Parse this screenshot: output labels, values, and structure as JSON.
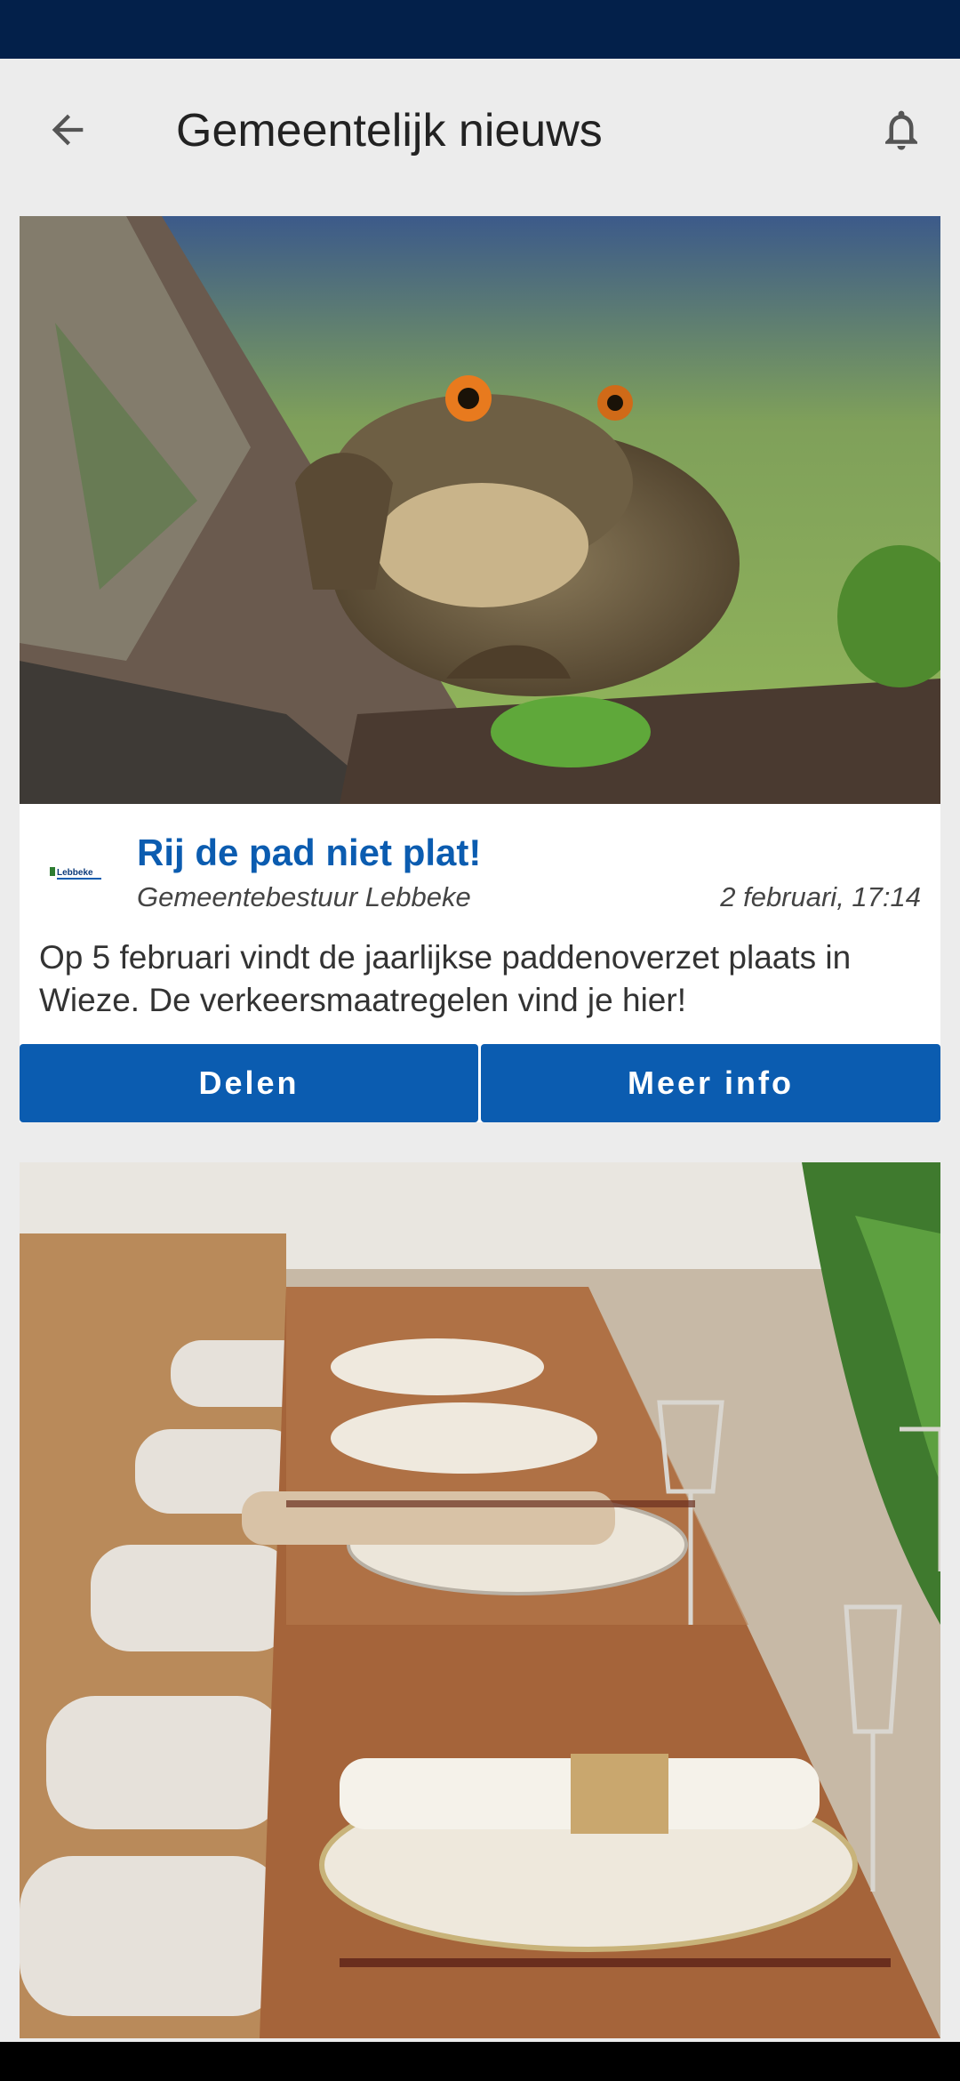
{
  "app_bar": {
    "title": "Gemeentelijk nieuws",
    "back_icon": "arrow-left-icon",
    "notification_icon": "bell-icon"
  },
  "feed": [
    {
      "image_subject": "toad on mossy tree bark",
      "source_logo_text": "Lebbeke",
      "title": "Rij de pad niet plat!",
      "source": "Gemeentebestuur Lebbeke",
      "date": "2 februari, 17:14",
      "body": "Op 5 februari vindt de jaarlijkse paddenoverzet plaats in Wieze. De verkeersmaatregelen vind je hier!",
      "share_label": "Delen",
      "more_label": "Meer info"
    },
    {
      "image_subject": "long dinner table set with plates, napkins and glasses"
    }
  ],
  "colors": {
    "status_bar": "#03204a",
    "accent": "#0b5cb0",
    "background": "#ececec"
  }
}
